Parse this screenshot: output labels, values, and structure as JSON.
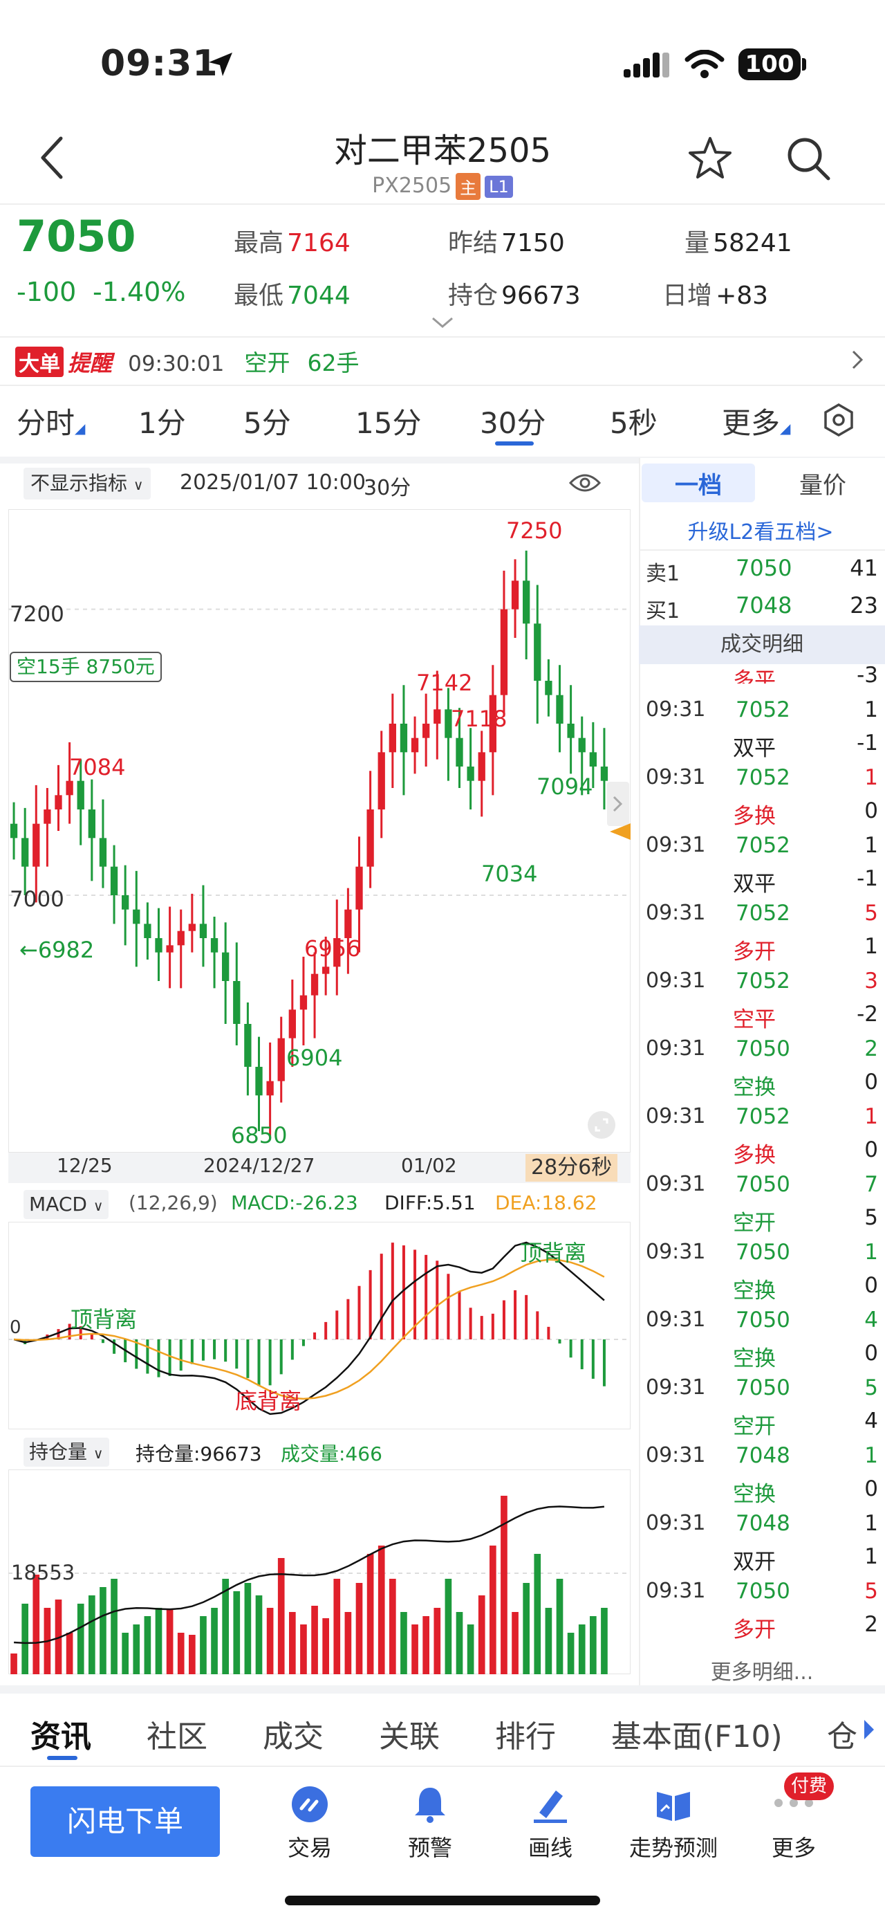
{
  "status_bar": {
    "time": "09:31",
    "battery": "100"
  },
  "header": {
    "title": "对二甲苯2505",
    "code": "PX2505",
    "tag_main": "主",
    "tag_l1": "L1"
  },
  "quote": {
    "price": "7050",
    "change": "-100",
    "change_pct": "-1.40%",
    "high_label": "最高",
    "high": "7164",
    "low_label": "最低",
    "low": "7044",
    "prev_settle_label": "昨结",
    "prev_settle": "7150",
    "open_interest_label": "持仓",
    "open_interest": "96673",
    "volume_label": "量",
    "volume": "58241",
    "daily_add_label": "日增",
    "daily_add": "+83"
  },
  "alert": {
    "badge_a": "大单",
    "badge_b": "提醒",
    "time": "09:30:01",
    "type": "空开",
    "lots": "62手"
  },
  "period_tabs": [
    "分时",
    "1分",
    "5分",
    "15分",
    "30分",
    "5秒",
    "更多"
  ],
  "active_period": "30分",
  "chart_header": {
    "indicator_select": "不显示指标",
    "datetime": "2025/01/07 10:00",
    "period": "30分"
  },
  "position_tag": "空15手 8750元",
  "countdown": "28分6秒",
  "colors": {
    "up": "#e0202b",
    "down": "#1d9a3c",
    "accent": "#2a67d8",
    "dea": "#f0a020"
  },
  "macd_header": {
    "name": "MACD",
    "params": "(12,26,9)",
    "macd": "MACD:-26.23",
    "diff": "DIFF:5.51",
    "dea": "DEA:18.62"
  },
  "oi_header": {
    "name": "持仓量",
    "oi": "持仓量:96673",
    "vol": "成交量:466"
  },
  "chart_data": {
    "type": "candlestick",
    "y_labels": [
      "7200",
      "7000"
    ],
    "x_labels": [
      "12/25",
      "2024/12/27",
      "01/02"
    ],
    "annotations": [
      {
        "text": "7250",
        "color": "red"
      },
      {
        "text": "7142",
        "color": "red"
      },
      {
        "text": "7118",
        "color": "red"
      },
      {
        "text": "7084",
        "color": "red"
      },
      {
        "text": "6956",
        "color": "red"
      },
      {
        "text": "7094",
        "color": "green"
      },
      {
        "text": "7034",
        "color": "green"
      },
      {
        "text": "←6982",
        "color": "green"
      },
      {
        "text": "6904",
        "color": "green"
      },
      {
        "text": "6850",
        "color": "green"
      }
    ],
    "close": [
      7040,
      7020,
      7050,
      7060,
      7070,
      7080,
      7060,
      7040,
      7020,
      7000,
      6990,
      6980,
      6970,
      6960,
      6965,
      6975,
      6980,
      6970,
      6960,
      6940,
      6910,
      6880,
      6860,
      6870,
      6900,
      6920,
      6930,
      6945,
      6950,
      6970,
      6990,
      7020,
      7060,
      7100,
      7120,
      7100,
      7110,
      7120,
      7130,
      7110,
      7090,
      7080,
      7100,
      7140,
      7200,
      7220,
      7190,
      7150,
      7140,
      7120,
      7110,
      7100,
      7090,
      7080
    ],
    "macd_labels": [
      "顶背离",
      "底背离",
      "顶背离"
    ],
    "oi_level_label": "18553"
  },
  "orderbook": {
    "tab_level1": "一档",
    "tab_volprice": "量价",
    "upgrade": "升级L2看五档>",
    "sell_label": "卖1",
    "sell_price": "7050",
    "sell_vol": "41",
    "buy_label": "买1",
    "buy_price": "7048",
    "buy_vol": "23",
    "ticks_title": "成交明细",
    "partial_type": "多平",
    "partial_vol": "-3",
    "ticks": [
      {
        "time": "09:31",
        "price": "7052",
        "vol": "1",
        "vol_color": "dark",
        "type": "双平",
        "type_color": "dark",
        "chg": "-1"
      },
      {
        "time": "09:31",
        "price": "7052",
        "vol": "1",
        "vol_color": "red",
        "type": "多换",
        "type_color": "red",
        "chg": "0"
      },
      {
        "time": "09:31",
        "price": "7052",
        "vol": "1",
        "vol_color": "dark",
        "type": "双平",
        "type_color": "dark",
        "chg": "-1"
      },
      {
        "time": "09:31",
        "price": "7052",
        "vol": "5",
        "vol_color": "red",
        "type": "多开",
        "type_color": "red",
        "chg": "1"
      },
      {
        "time": "09:31",
        "price": "7052",
        "vol": "3",
        "vol_color": "red",
        "type": "空平",
        "type_color": "red",
        "chg": "-2"
      },
      {
        "time": "09:31",
        "price": "7050",
        "vol": "2",
        "vol_color": "green",
        "type": "空换",
        "type_color": "green",
        "chg": "0"
      },
      {
        "time": "09:31",
        "price": "7052",
        "vol": "1",
        "vol_color": "red",
        "type": "多换",
        "type_color": "red",
        "chg": "0"
      },
      {
        "time": "09:31",
        "price": "7050",
        "vol": "7",
        "vol_color": "green",
        "type": "空开",
        "type_color": "green",
        "chg": "5"
      },
      {
        "time": "09:31",
        "price": "7050",
        "vol": "1",
        "vol_color": "green",
        "type": "空换",
        "type_color": "green",
        "chg": "0"
      },
      {
        "time": "09:31",
        "price": "7050",
        "vol": "4",
        "vol_color": "green",
        "type": "空换",
        "type_color": "green",
        "chg": "0"
      },
      {
        "time": "09:31",
        "price": "7050",
        "vol": "5",
        "vol_color": "green",
        "type": "空开",
        "type_color": "green",
        "chg": "4"
      },
      {
        "time": "09:31",
        "price": "7048",
        "vol": "1",
        "vol_color": "green",
        "type": "空换",
        "type_color": "green",
        "chg": "0"
      },
      {
        "time": "09:31",
        "price": "7048",
        "vol": "1",
        "vol_color": "dark",
        "type": "双开",
        "type_color": "dark",
        "chg": "1"
      },
      {
        "time": "09:31",
        "price": "7050",
        "vol": "5",
        "vol_color": "red",
        "type": "多开",
        "type_color": "red",
        "chg": "2"
      }
    ],
    "more": "更多明细..."
  },
  "bottom_tabs": [
    "资讯",
    "社区",
    "成交",
    "关联",
    "排行",
    "基本面(F10)",
    "仓"
  ],
  "toolbar": {
    "flash_order": "闪电下单",
    "items": [
      {
        "label": "交易",
        "icon": "trade-icon"
      },
      {
        "label": "预警",
        "icon": "bell-icon"
      },
      {
        "label": "画线",
        "icon": "draw-line-icon"
      },
      {
        "label": "走势预测",
        "icon": "forecast-icon"
      },
      {
        "label": "更多",
        "icon": "more-icon"
      }
    ],
    "paid_badge": "付费"
  }
}
